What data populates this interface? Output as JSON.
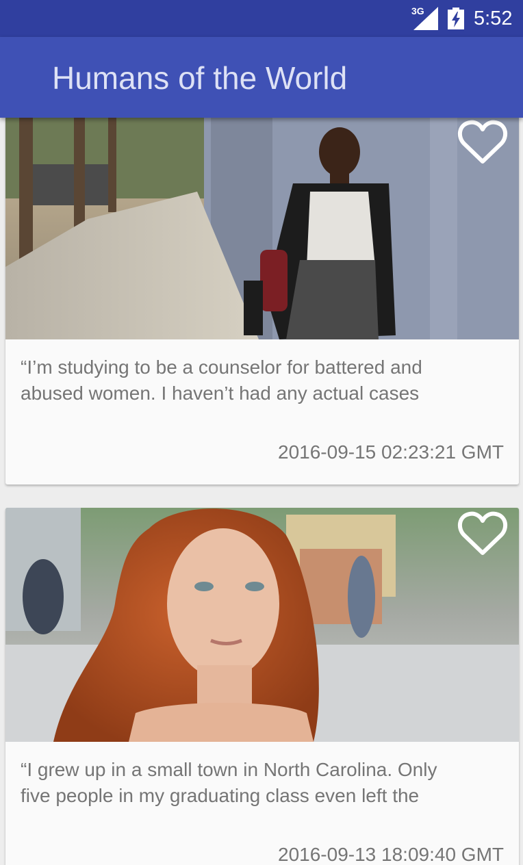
{
  "status_bar": {
    "network": "3G",
    "time": "5:52",
    "icons": [
      "signal-icon",
      "battery-charging-icon"
    ]
  },
  "app_bar": {
    "title": "Humans of the World"
  },
  "posts": [
    {
      "caption": "“I’m studying to be a counselor for battered and\nabused women. I haven’t had any actual cases",
      "timestamp": "2016-09-15 02:23:21 GMT",
      "favorite_icon": "heart-outline-icon"
    },
    {
      "caption": "“I grew up in a small town in North Carolina. Only\nfive people in my graduating class even left the",
      "timestamp": "2016-09-13 18:09:40 GMT",
      "favorite_icon": "heart-outline-icon"
    }
  ],
  "colors": {
    "status_bar": "#303f9f",
    "app_bar": "#3f51b5",
    "card_background": "#fafafa",
    "page_background": "#ededed",
    "secondary_text": "#757575"
  }
}
